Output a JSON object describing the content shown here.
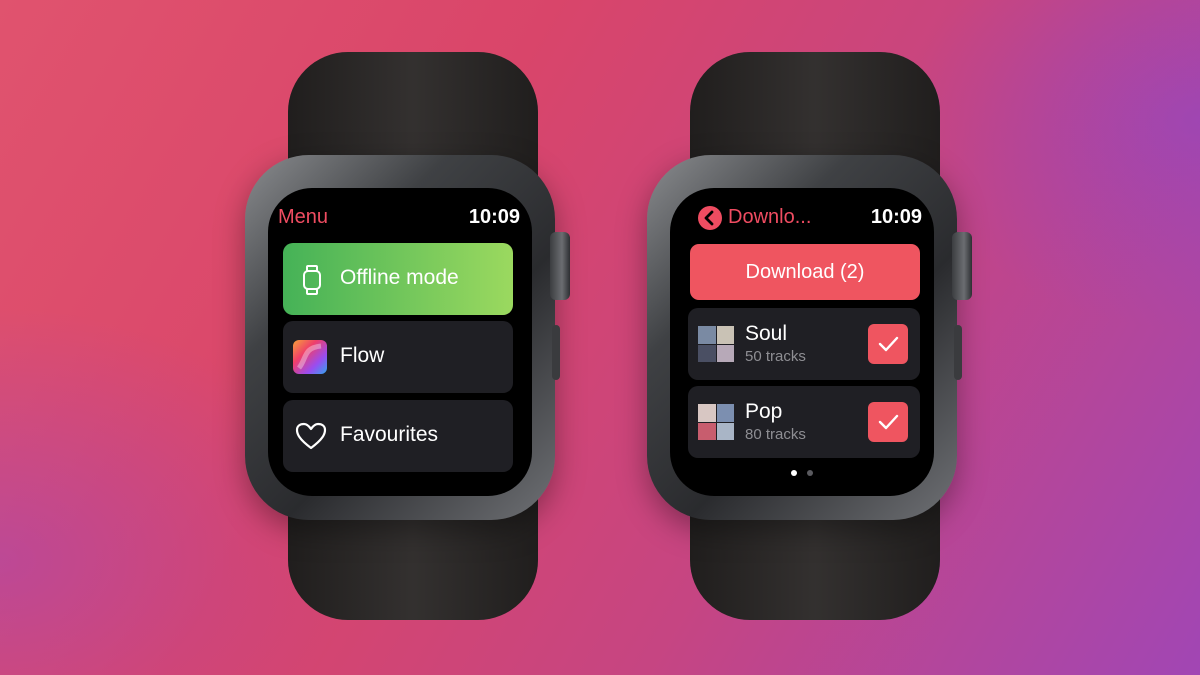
{
  "left_watch": {
    "title": "Menu",
    "time": "10:09",
    "items": [
      {
        "label": "Offline mode",
        "icon": "watch-icon",
        "highlighted": true
      },
      {
        "label": "Flow",
        "icon": "flow-icon"
      },
      {
        "label": "Favourites",
        "icon": "heart-icon"
      }
    ]
  },
  "right_watch": {
    "title": "Downlo...",
    "time": "10:09",
    "back_icon": "back-chevron-icon",
    "download_button": "Download (2)",
    "playlists": [
      {
        "name": "Soul",
        "tracks": "50 tracks",
        "checked": true
      },
      {
        "name": "Pop",
        "tracks": "80 tracks",
        "checked": true
      }
    ],
    "page_indicator": {
      "pages": 2,
      "current": 1
    }
  },
  "colors": {
    "accent": "#ef5560",
    "title_red": "#ef4c61",
    "row_bg": "#1f1f24",
    "green_start": "#45b257",
    "green_end": "#9bd95f"
  }
}
